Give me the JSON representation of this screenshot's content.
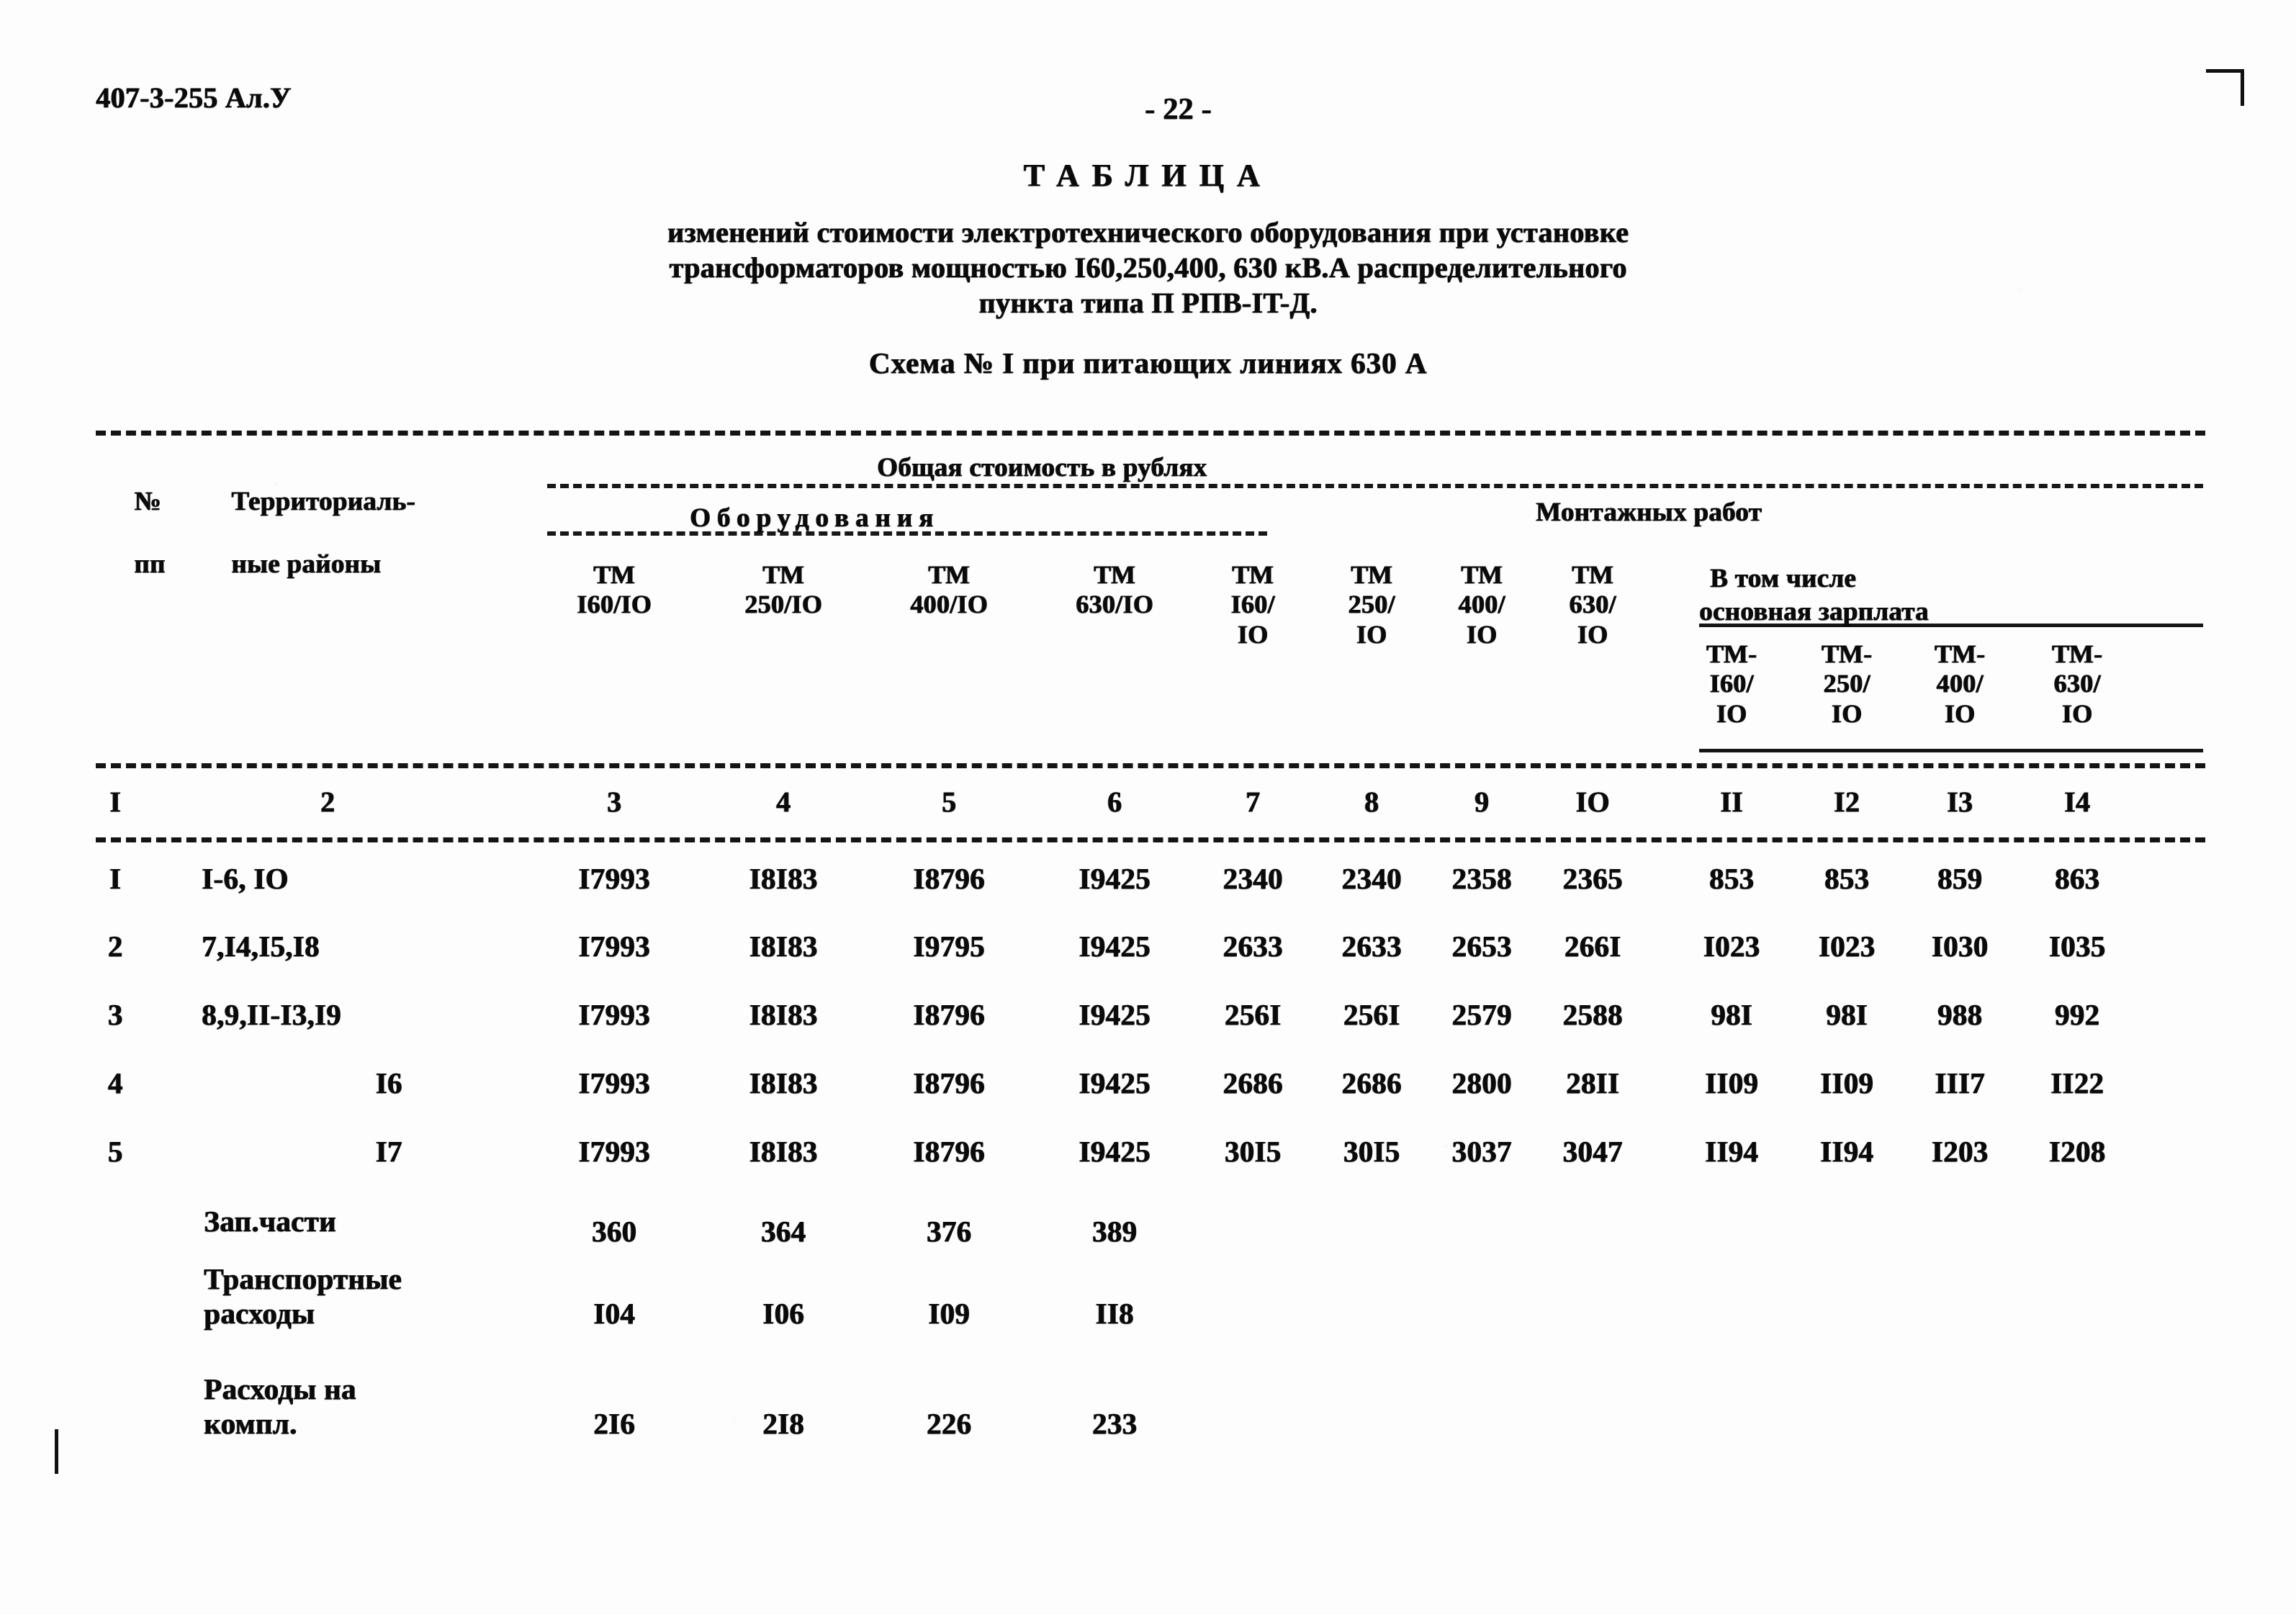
{
  "header": {
    "doc_code": "407-3-255  Ал.У",
    "page_number": "- 22 -"
  },
  "title": {
    "word": "ТАБЛИЦА",
    "line1": "изменений стоимости электротехнического оборудования при установке",
    "line2": "трансформаторов мощностью I60,250,400, 630 кВ.А распределительного",
    "line3": "пункта типа П РПВ-IT-Д.",
    "scheme": "Схема № I при питающих линиях 630 А"
  },
  "table": {
    "head": {
      "num_label_1": "№",
      "num_label_2": "пп",
      "region_1": "Территориаль-",
      "region_2": "ные районы",
      "group_total": "Общая стоимость в рублях",
      "group_equipment": "Оборудования",
      "group_montage": "Монтажных работ",
      "group_including_1": "В том числе",
      "group_including_2": "основная зарплата",
      "equipment_cols": [
        {
          "l1": "ТМ",
          "l2": "I60/IO"
        },
        {
          "l1": "ТМ",
          "l2": "250/IO"
        },
        {
          "l1": "ТМ",
          "l2": "400/IO"
        },
        {
          "l1": "ТМ",
          "l2": "630/IO"
        }
      ],
      "montage_cols": [
        {
          "l1": "ТМ",
          "l2": "I60/",
          "l3": "IO"
        },
        {
          "l1": "ТМ",
          "l2": "250/",
          "l3": "IO"
        },
        {
          "l1": "ТМ",
          "l2": "400/",
          "l3": "IO"
        },
        {
          "l1": "ТМ",
          "l2": "630/",
          "l3": "IO"
        }
      ],
      "salary_cols": [
        {
          "l1": "ТМ-",
          "l2": "I60/",
          "l3": "IO"
        },
        {
          "l1": "ТМ-",
          "l2": "250/",
          "l3": "IO"
        },
        {
          "l1": "ТМ-",
          "l2": "400/",
          "l3": "IO"
        },
        {
          "l1": "ТМ-",
          "l2": "630/",
          "l3": "IO"
        }
      ],
      "column_numbers": [
        "I",
        "2",
        "3",
        "4",
        "5",
        "6",
        "7",
        "8",
        "9",
        "IO",
        "II",
        "I2",
        "I3",
        "I4"
      ]
    },
    "rows": [
      {
        "num": "I",
        "region": "I-6, IO",
        "equipment": [
          "I7993",
          "I8I83",
          "I8796",
          "I9425"
        ],
        "montage": [
          "2340",
          "2340",
          "2358",
          "2365"
        ],
        "salary": [
          "853",
          "853",
          "859",
          "863"
        ]
      },
      {
        "num": "2",
        "region": "7,I4,I5,I8",
        "equipment": [
          "I7993",
          "I8I83",
          "I9795",
          "I9425"
        ],
        "montage": [
          "2633",
          "2633",
          "2653",
          "266I"
        ],
        "salary": [
          "I023",
          "I023",
          "I030",
          "I035"
        ]
      },
      {
        "num": "3",
        "region": "8,9,II-I3,I9",
        "equipment": [
          "I7993",
          "I8I83",
          "I8796",
          "I9425"
        ],
        "montage": [
          "256I",
          "256I",
          "2579",
          "2588"
        ],
        "salary": [
          "98I",
          "98I",
          "988",
          "992"
        ]
      },
      {
        "num": "4",
        "region": "I6",
        "equipment": [
          "I7993",
          "I8I83",
          "I8796",
          "I9425"
        ],
        "montage": [
          "2686",
          "2686",
          "2800",
          "28II"
        ],
        "salary": [
          "II09",
          "II09",
          "III7",
          "II22"
        ]
      },
      {
        "num": "5",
        "region": "I7",
        "equipment": [
          "I7993",
          "I8I83",
          "I8796",
          "I9425"
        ],
        "montage": [
          "30I5",
          "30I5",
          "3037",
          "3047"
        ],
        "salary": [
          "II94",
          "II94",
          "I203",
          "I208"
        ]
      }
    ],
    "extra_rows": [
      {
        "label_1": "Зап.части",
        "label_2": "",
        "values": [
          "360",
          "364",
          "376",
          "389"
        ]
      },
      {
        "label_1": "Транспортные",
        "label_2": "расходы",
        "values": [
          "I04",
          "I06",
          "I09",
          "II8"
        ]
      },
      {
        "label_1": "Расходы на",
        "label_2": "компл.",
        "values": [
          "2I6",
          "2I8",
          "226",
          "233"
        ]
      }
    ]
  }
}
